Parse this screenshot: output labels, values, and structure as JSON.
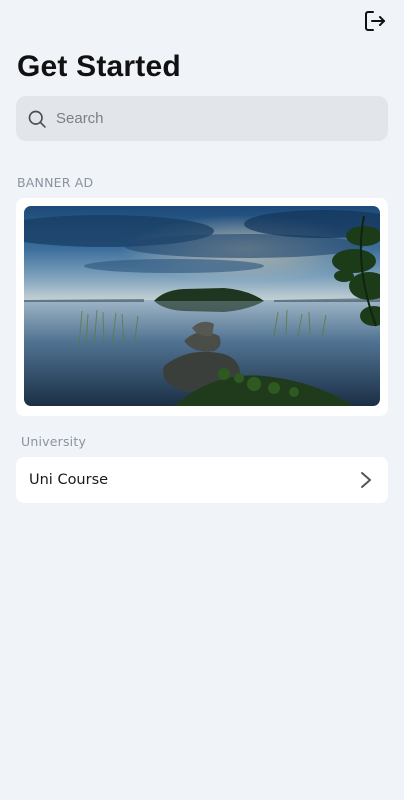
{
  "header": {
    "title": "Get Started",
    "logout_icon": "logout-icon"
  },
  "search": {
    "placeholder": "Search",
    "icon": "search-icon"
  },
  "banner": {
    "section_label": "BANNER AD",
    "image_description": "lake-landscape-at-dusk"
  },
  "university": {
    "section_label": "University",
    "items": [
      {
        "label": "Uni Course",
        "icon": "chevron-right-icon"
      }
    ]
  },
  "colors": {
    "background": "#f0f3f8",
    "search_bg": "#e2e5ea",
    "card_bg": "#ffffff",
    "section_label": "#8a93a0",
    "title": "#111111"
  }
}
